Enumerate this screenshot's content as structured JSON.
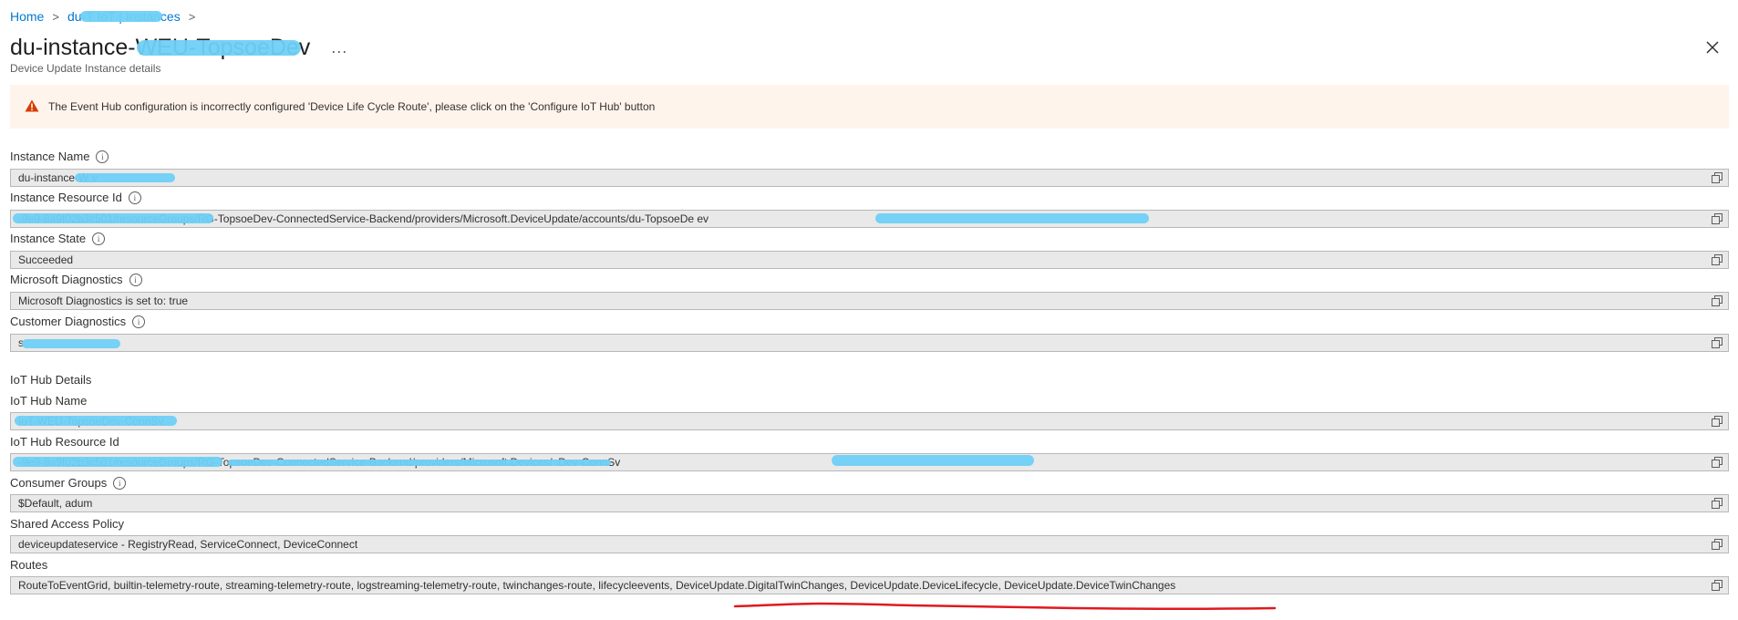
{
  "breadcrumb": {
    "home": "Home",
    "parent": "du-T        IoT | Instances",
    "separator": ">"
  },
  "header": {
    "title": "du-instance-WEU-TopsoeDev",
    "more": "...",
    "subtitle": "Device Update Instance details",
    "close_icon": "close-icon"
  },
  "warning": {
    "icon": "warning-triangle-icon",
    "color": "#d83b01",
    "text": "The Event Hub configuration is incorrectly configured 'Device Life Cycle Route', please click on the 'Configure IoT Hub' button"
  },
  "instance": {
    "name_label": "Instance Name",
    "name_value": "du-instance-W      v",
    "resource_id_label": "Instance Resource Id",
    "resource_id_value": "                                      -9e9-8a9f02b3c501/resourceGroups/RG-TopsoeDev-ConnectedService-Backend/providers/Microsoft.DeviceUpdate/accounts/du-TopsoeDe                              ev",
    "state_label": "Instance State",
    "state_value": "Succeeded",
    "diag_label": "Microsoft Diagnostics",
    "diag_value": "Microsoft Diagnostics is set to: true",
    "cust_diag_label": "Customer Diagnostics",
    "cust_diag_value": "s"
  },
  "iothub": {
    "section_title": "IoT Hub Details",
    "name_label": "IoT Hub Name",
    "name_value": "IoT-WEU-TopsoeDev-ConnSv",
    "resource_id_label": "IoT Hub Resource Id",
    "resource_id_value": "                              -9e9-8a9f02b3c501/resourceGroups/RG-TopsoeDev-ConnectedService-Backend/providers/Microsoft.Devices/                         .Dev-ConnSv",
    "consumer_label": "Consumer Groups",
    "consumer_value": "$Default, adum",
    "policy_label": "Shared Access Policy",
    "policy_value": "deviceupdateservice - RegistryRead, ServiceConnect, DeviceConnect",
    "routes_label": "Routes",
    "routes_value": "RouteToEventGrid, builtin-telemetry-route, streaming-telemetry-route, logstreaming-telemetry-route, twinchanges-route, lifecycleevents, DeviceUpdate.DigitalTwinChanges, DeviceUpdate.DeviceLifecycle, DeviceUpdate.DeviceTwinChanges"
  },
  "icons": {
    "info": "info-icon",
    "copy": "copy-icon"
  },
  "colors": {
    "link": "#0078d4",
    "warning_bg": "#fff4ec",
    "redaction": "#6fd0f5",
    "annotation": "#e0191f"
  }
}
